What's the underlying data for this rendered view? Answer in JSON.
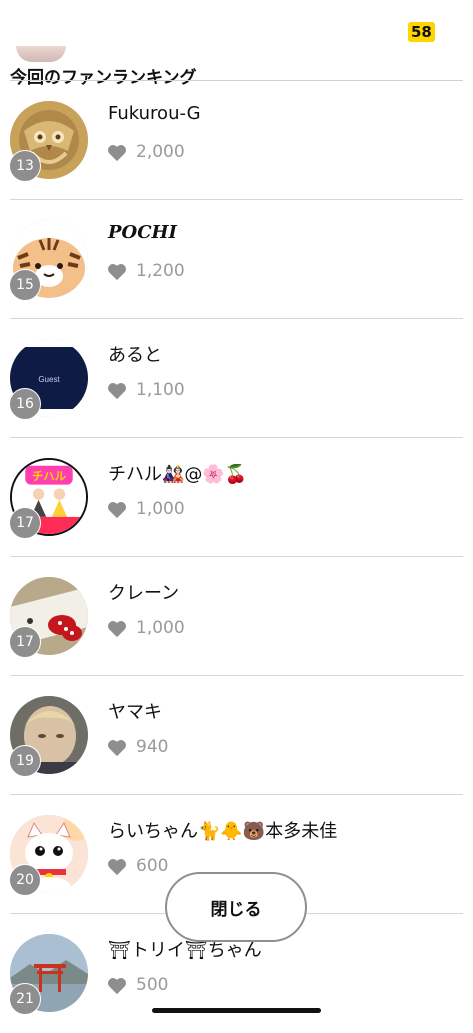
{
  "status": {
    "badge": "58"
  },
  "title": "今回のファンランキング",
  "colors": {
    "heart": "#8e8e8e",
    "rank_badge": "#8e8e8e",
    "accent_badge": "#ffd400"
  },
  "ranking": [
    {
      "rank": "13",
      "name": "Fukurou-G",
      "points": "2,000",
      "avatar_icon": "owl-emblem-icon"
    },
    {
      "rank": "15",
      "name": "POCHI",
      "points": "1,200",
      "avatar_icon": "tiger-character-icon"
    },
    {
      "rank": "16",
      "name": "あると",
      "points": "1,100",
      "avatar_icon": "guest-avatar-icon",
      "avatar_text": "Guest"
    },
    {
      "rank": "17",
      "name": "チハル🎎@🌸🍒",
      "points": "1,000",
      "avatar_icon": "hina-doll-icon",
      "avatar_text": "チハル"
    },
    {
      "rank": "17",
      "name": "クレーン",
      "points": "1,000",
      "avatar_icon": "ribbon-photo-icon"
    },
    {
      "rank": "19",
      "name": "ヤマキ",
      "points": "940",
      "avatar_icon": "portrait-photo-icon"
    },
    {
      "rank": "20",
      "name": "らいちゃん🐈🐥🐻本多未佳",
      "points": "600",
      "avatar_icon": "lucky-cat-icon"
    },
    {
      "rank": "21",
      "name": "⛩トリイ⛩ちゃん",
      "points": "500",
      "avatar_icon": "torii-photo-icon"
    }
  ],
  "close_button": {
    "label": "閉じる"
  }
}
